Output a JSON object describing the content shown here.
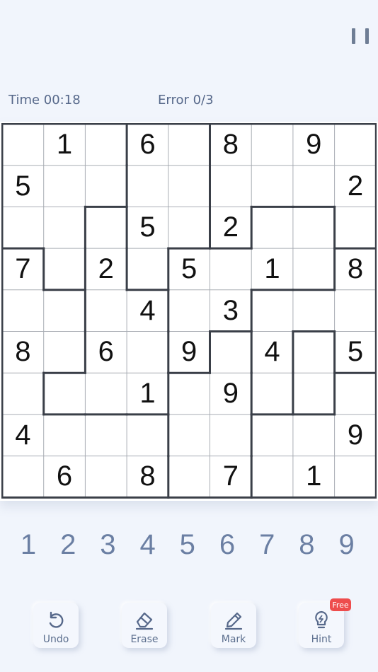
{
  "header": {
    "time_label": "Time 00:18",
    "error_label": "Error 0/3"
  },
  "board": {
    "rows": [
      [
        "",
        "1",
        "",
        "6",
        "",
        "8",
        "",
        "9",
        ""
      ],
      [
        "5",
        "",
        "",
        "",
        "",
        "",
        "",
        "",
        "2"
      ],
      [
        "",
        "",
        "",
        "5",
        "",
        "2",
        "",
        "",
        ""
      ],
      [
        "7",
        "",
        "2",
        "",
        "5",
        "",
        "1",
        "",
        "8"
      ],
      [
        "",
        "",
        "",
        "4",
        "",
        "3",
        "",
        "",
        ""
      ],
      [
        "8",
        "",
        "6",
        "",
        "9",
        "",
        "4",
        "",
        "5"
      ],
      [
        "",
        "",
        "",
        "1",
        "",
        "9",
        "",
        "",
        ""
      ],
      [
        "4",
        "",
        "",
        "",
        "",
        "",
        "",
        "",
        "9"
      ],
      [
        "",
        "6",
        "",
        "8",
        "",
        "7",
        "",
        "1",
        ""
      ]
    ],
    "regions": [
      [
        0,
        0,
        0,
        1,
        1,
        2,
        2,
        2,
        2
      ],
      [
        0,
        0,
        0,
        1,
        1,
        2,
        2,
        2,
        2
      ],
      [
        0,
        0,
        3,
        1,
        1,
        2,
        4,
        4,
        2
      ],
      [
        5,
        0,
        3,
        1,
        4,
        4,
        4,
        4,
        6
      ],
      [
        5,
        5,
        3,
        3,
        4,
        4,
        6,
        6,
        6
      ],
      [
        5,
        5,
        3,
        3,
        4,
        7,
        6,
        7,
        6
      ],
      [
        5,
        3,
        3,
        3,
        7,
        7,
        6,
        7,
        8
      ],
      [
        5,
        5,
        5,
        5,
        7,
        7,
        8,
        8,
        8
      ],
      [
        5,
        5,
        5,
        5,
        7,
        7,
        8,
        8,
        8
      ]
    ]
  },
  "numpad": [
    "1",
    "2",
    "3",
    "4",
    "5",
    "6",
    "7",
    "8",
    "9"
  ],
  "tools": {
    "undo": "Undo",
    "erase": "Erase",
    "mark": "Mark",
    "hint": "Hint",
    "hint_badge": "Free"
  },
  "icons": {
    "pause": "pause-icon",
    "undo": "undo-icon",
    "erase": "eraser-icon",
    "mark": "pencil-icon",
    "hint": "lightbulb-icon"
  },
  "colors": {
    "background": "#f1f5fc",
    "grid_thin": "#a9adb4",
    "grid_thick": "#3a3f48",
    "numpad": "#6b7fa3",
    "badge": "#ee4d4d"
  }
}
